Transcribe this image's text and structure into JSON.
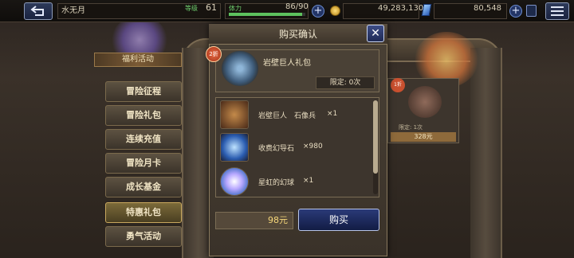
{
  "topbar": {
    "player_name": "水无月",
    "level_label": "等级",
    "level_value": "61",
    "stamina_label": "体力",
    "stamina_value": "86/90",
    "stamina_fraction": 0.955,
    "gold_value": "49,283,130",
    "gem_value": "80,548"
  },
  "sidebar": {
    "title": "福利活动",
    "items": [
      {
        "label": "冒险征程"
      },
      {
        "label": "冒险礼包"
      },
      {
        "label": "连续充值"
      },
      {
        "label": "冒险月卡"
      },
      {
        "label": "成长基金"
      },
      {
        "label": "特惠礼包"
      },
      {
        "label": "勇气活动"
      }
    ]
  },
  "background_card": {
    "badge": "1折",
    "limit": "限定: 1次",
    "price": "328元"
  },
  "dialog": {
    "title": "购买确认",
    "discount_badge": "2折",
    "pack_name": "岩壁巨人礼包",
    "limit": "限定: 0次",
    "items": [
      {
        "name": "岩壁巨人　石像兵",
        "qty": "×1",
        "icon": "golem-unit-icon"
      },
      {
        "name": "收费幻导石",
        "qty": "×980",
        "icon": "crystal-icon"
      },
      {
        "name": "星虹的幻球",
        "qty": "×1",
        "icon": "orb-icon"
      }
    ],
    "price": "98元",
    "buy_label": "购买"
  },
  "colors": {
    "accent_blue": "#1f2a55",
    "gold_text": "#f6d77a",
    "discount_red": "#c9502f"
  }
}
